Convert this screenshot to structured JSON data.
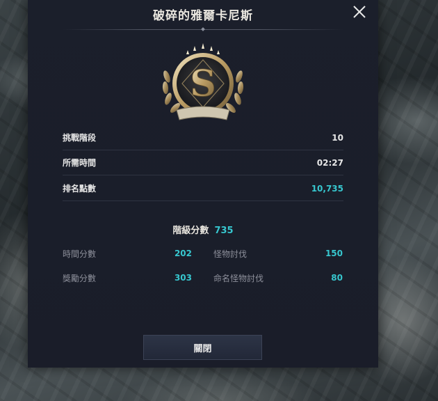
{
  "dialog": {
    "title": "破碎的雅爾卡尼斯",
    "close_icon": "close-icon",
    "emblem": {
      "letter": "S",
      "icon": "rank-s-emblem-icon"
    }
  },
  "stats": [
    {
      "label": "挑戰階段",
      "value": "10",
      "color": "#e6e6e6"
    },
    {
      "label": "所需時間",
      "value": "02:27",
      "color": "#e6e6e6"
    },
    {
      "label": "排名點數",
      "value": "10,735",
      "color": "#37c7cf"
    }
  ],
  "grade": {
    "label": "階級分數",
    "value": "735"
  },
  "breakdown": [
    {
      "label": "時間分數",
      "value": "202"
    },
    {
      "label": "怪物討伐",
      "value": "150"
    },
    {
      "label": "獎勵分數",
      "value": "303"
    },
    {
      "label": "命名怪物討伐",
      "value": "80"
    }
  ],
  "footer": {
    "close_button_label": "關閉"
  },
  "colors": {
    "accent": "#37c7cf",
    "panel": "#1b1f2b"
  }
}
